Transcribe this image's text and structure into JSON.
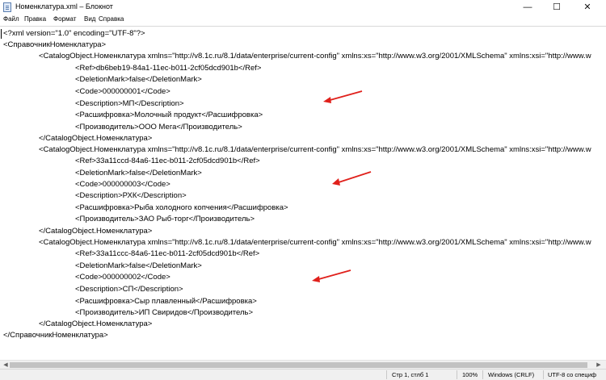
{
  "window": {
    "title": "Номенклатура.xml – Блокнот",
    "minimize_glyph": "—",
    "maximize_glyph": "☐",
    "close_glyph": "✕"
  },
  "menu": [
    "Файл",
    "Правка",
    "Формат",
    "Вид",
    "Справка"
  ],
  "lines": [
    "<?xml version=\"1.0\" encoding=\"UTF-8\"?>",
    "<СправочникНоменклатура>",
    "<CatalogObject.Номенклатура xmlns=\"http://v8.1c.ru/8.1/data/enterprise/current-config\" xmlns:xs=\"http://www.w3.org/2001/XMLSchema\" xmlns:xsi=\"http://www.w",
    "<Ref>db6beb19-84a1-11ec-b011-2cf05dcd901b</Ref>",
    "<DeletionMark>false</DeletionMark>",
    "<Code>000000001</Code>",
    "<Description>МП</Description>",
    "<Расшифровка>Молочный продукт</Расшифровка>",
    "<Производитель>ООО Мега</Производитель>",
    "</CatalogObject.Номенклатура>",
    "<CatalogObject.Номенклатура xmlns=\"http://v8.1c.ru/8.1/data/enterprise/current-config\" xmlns:xs=\"http://www.w3.org/2001/XMLSchema\" xmlns:xsi=\"http://www.w",
    "<Ref>33a11ccd-84a6-11ec-b011-2cf05dcd901b</Ref>",
    "<DeletionMark>false</DeletionMark>",
    "<Code>000000003</Code>",
    "<Description>РХК</Description>",
    "<Расшифровка>Рыба холодного копчения</Расшифровка>",
    "<Производитель>ЗАО Рыб-торг</Производитель>",
    "</CatalogObject.Номенклатура>",
    "<CatalogObject.Номенклатура xmlns=\"http://v8.1c.ru/8.1/data/enterprise/current-config\" xmlns:xs=\"http://www.w3.org/2001/XMLSchema\" xmlns:xsi=\"http://www.w",
    "<Ref>33a11ccc-84a6-11ec-b011-2cf05dcd901b</Ref>",
    "<DeletionMark>false</DeletionMark>",
    "<Code>000000002</Code>",
    "<Description>СП</Description>",
    "<Расшифровка>Сыр плавленный</Расшифровка>",
    "<Производитель>ИП Свиридов</Производитель>",
    "</CatalogObject.Номенклатура>",
    "</СправочникНоменклатура>"
  ],
  "annotation_color": "#e0201b",
  "status": {
    "position": "Стр 1, стлб 1",
    "zoom": "100%",
    "line_ending": "Windows (CRLF)",
    "encoding": "UTF-8 со специф"
  }
}
